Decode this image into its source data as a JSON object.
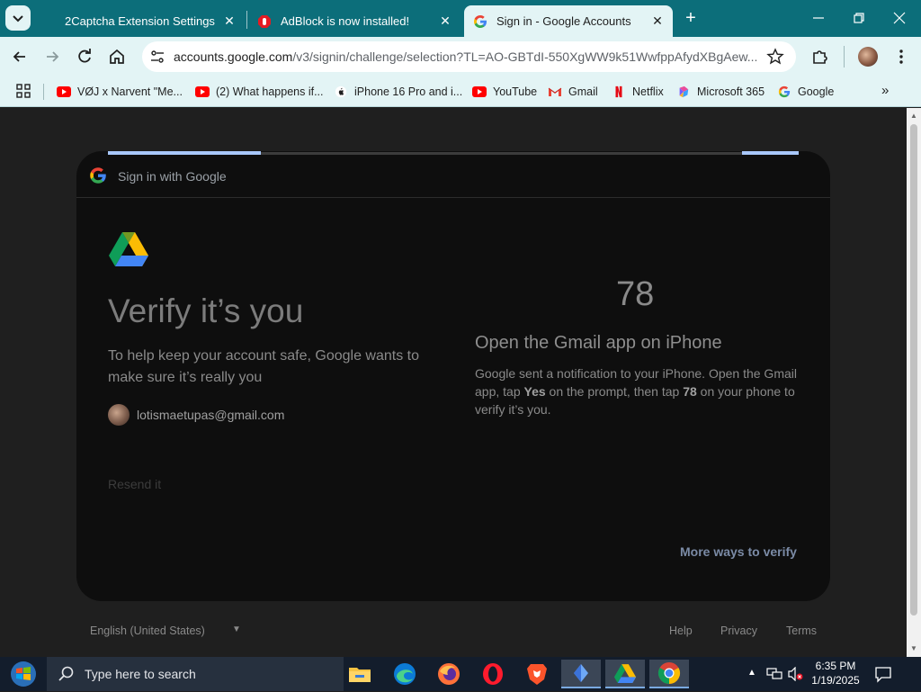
{
  "browser": {
    "tabs": [
      {
        "title": "2Captcha Extension Settings",
        "icon": "2captcha-icon",
        "active": false
      },
      {
        "title": "AdBlock is now installed!",
        "icon": "adblock-icon",
        "active": false
      },
      {
        "title": "Sign in - Google Accounts",
        "icon": "google-icon",
        "active": true
      }
    ],
    "omnibox": {
      "domain": "accounts.google.com",
      "path": "/v3/signin/challenge/selection?TL=AO-GBTdI-550XgWW9k51WwfppAfydXBgAew..."
    },
    "bookmarks": [
      {
        "label": "VØJ x Narvent \"Me...",
        "icon": "youtube-icon"
      },
      {
        "label": "(2) What happens if...",
        "icon": "youtube-icon"
      },
      {
        "label": "iPhone 16 Pro and i...",
        "icon": "apple-icon"
      },
      {
        "label": "YouTube",
        "icon": "youtube-icon"
      },
      {
        "label": "Gmail",
        "icon": "gmail-icon"
      },
      {
        "label": "Netflix",
        "icon": "netflix-icon"
      },
      {
        "label": "Microsoft 365",
        "icon": "microsoft365-icon"
      },
      {
        "label": "Google",
        "icon": "google-icon"
      }
    ]
  },
  "signin": {
    "header_label": "Sign in with Google",
    "title": "Verify it’s you",
    "subtitle": "To help keep your account safe, Google wants to make sure it’s really you",
    "email": "lotismaetupas@gmail.com",
    "resend": "Resend it",
    "number": "78",
    "right_heading": "Open the Gmail app on iPhone",
    "desc_1": "Google sent a notification to your iPhone. Open the Gmail app, tap ",
    "desc_yes": "Yes",
    "desc_2": " on the prompt, then tap ",
    "desc_num": "78",
    "desc_3": " on your phone to verify it’s you.",
    "more_ways": "More ways to verify"
  },
  "footer": {
    "language": "English (United States)",
    "help": "Help",
    "privacy": "Privacy",
    "terms": "Terms"
  },
  "taskbar": {
    "search_placeholder": "Type here to search",
    "time": "6:35 PM",
    "date": "1/19/2025"
  }
}
